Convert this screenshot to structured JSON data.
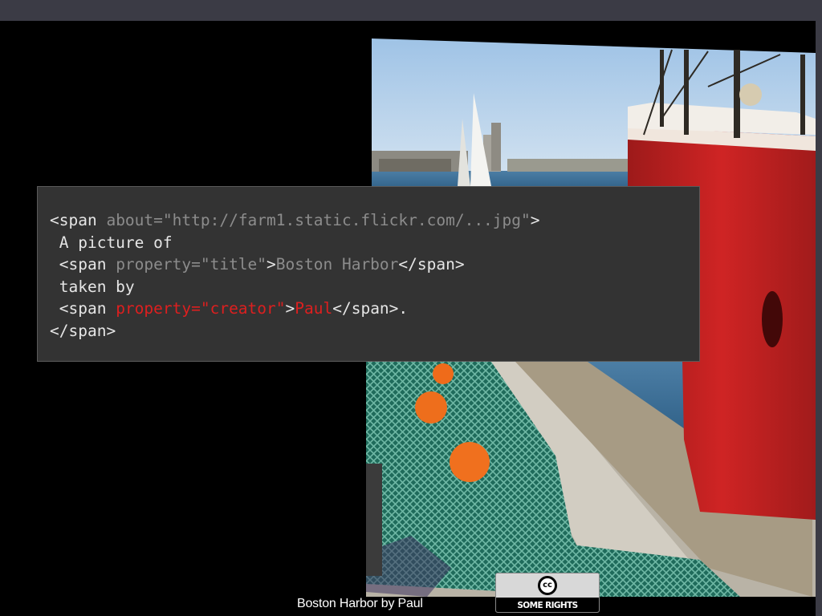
{
  "code": {
    "lines": [
      [
        {
          "t": "<span ",
          "c": "w"
        },
        {
          "t": "about=\"http://farm1.static.flickr.com/...jpg\"",
          "c": "g"
        },
        {
          "t": ">",
          "c": "w"
        }
      ],
      [
        {
          "t": " A picture of",
          "c": "w"
        }
      ],
      [
        {
          "t": " <span ",
          "c": "w"
        },
        {
          "t": "property=\"title\"",
          "c": "g"
        },
        {
          "t": ">",
          "c": "w"
        },
        {
          "t": "Boston Harbor",
          "c": "g"
        },
        {
          "t": "</span>",
          "c": "w"
        }
      ],
      [
        {
          "t": " taken by",
          "c": "w"
        }
      ],
      [
        {
          "t": " <span ",
          "c": "w"
        },
        {
          "t": "property=\"creator\"",
          "c": "r"
        },
        {
          "t": ">",
          "c": "w"
        },
        {
          "t": "Paul",
          "c": "r"
        },
        {
          "t": "</span>.",
          "c": "w"
        }
      ],
      [
        {
          "t": "</span>",
          "c": "w"
        }
      ]
    ]
  },
  "caption": "Boston Harbor by Paul",
  "license_badge": {
    "icon_text": "cc",
    "label": "SOME RIGHTS RESERVED"
  },
  "colors": {
    "slide_bg": "#000000",
    "frame": "#3b3b45",
    "code_bg": "#333333",
    "code_text": "#e6e6e6",
    "code_gray": "#8c8c8c",
    "code_red": "#dd1f1f"
  },
  "photo": {
    "icon": "harbor-photo"
  }
}
